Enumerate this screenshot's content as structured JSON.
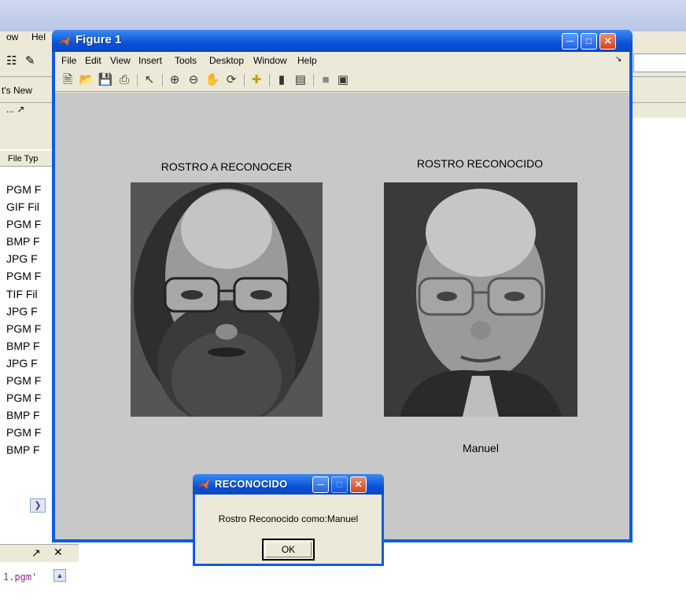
{
  "desktop": {
    "menu": [
      "ow",
      "Hel"
    ],
    "whats_new": "t's New",
    "col_header": "File Typ",
    "file_types": [
      "PGM F",
      "GIF Fil",
      "PGM F",
      "BMP F",
      "JPG F",
      "PGM F",
      "TIF Fil",
      "JPG F",
      "PGM F",
      "BMP F",
      "JPG F",
      "PGM F",
      "PGM F",
      "BMP F",
      "PGM F",
      "BMP F"
    ],
    "cmd_text": "1.pgm'"
  },
  "figure": {
    "title": "Figure 1",
    "menu": [
      "File",
      "Edit",
      "View",
      "Insert",
      "Tools",
      "Desktop",
      "Window",
      "Help"
    ],
    "toolbar_icons": [
      "new-file-icon",
      "open-folder-icon",
      "save-icon",
      "print-icon",
      "pointer-icon",
      "zoom-in-icon",
      "zoom-out-icon",
      "pan-hand-icon",
      "rotate-3d-icon",
      "data-cursor-icon",
      "colorbar-icon",
      "legend-icon",
      "hide-plot-tools-icon",
      "show-plot-tools-icon"
    ],
    "left_title": "ROSTRO A RECONOCER",
    "right_title": "ROSTRO RECONOCIDO",
    "recognized_name": "Manuel"
  },
  "dialog": {
    "title": "RECONOCIDO",
    "message": "Rostro Reconocido como:Manuel",
    "ok_label": "OK"
  }
}
